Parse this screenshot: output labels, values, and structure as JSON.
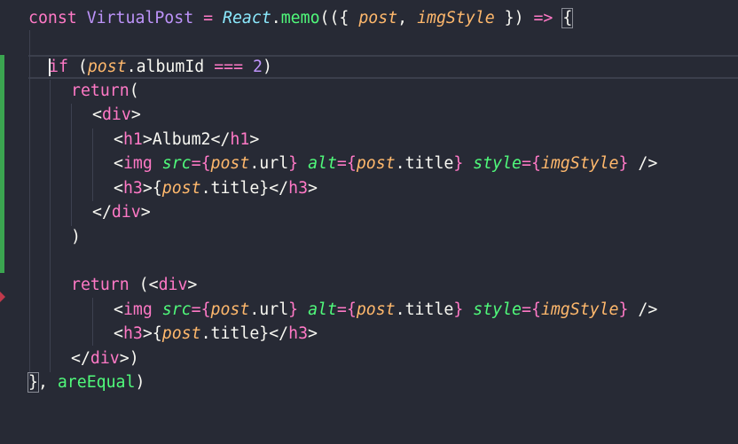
{
  "editor": {
    "line1": {
      "kw_const": "const",
      "name": "VirtualPost",
      "eq": "=",
      "react": "React",
      "dot": ".",
      "memo": "memo",
      "open": "(({",
      "post": "post",
      "comma": ",",
      "imgStyle": "imgStyle",
      "close": "})",
      "arrow": "=>",
      "brace": "{"
    },
    "line3": {
      "kw_if": "if",
      "paren_open": "(",
      "post": "post",
      "prop": ".albumId",
      "op": "===",
      "num": "2",
      "paren_close": ")"
    },
    "line4": {
      "kw_return": "return",
      "paren": "("
    },
    "line5": {
      "lt": "<",
      "tag": "div",
      "gt": ">"
    },
    "line6": {
      "lt": "<",
      "tag_open": "h1",
      "mid": ">Album2</",
      "tag_close": "h1",
      "gt": ">"
    },
    "img_line": {
      "lt": "<",
      "tag": "img",
      "attr_src": "src",
      "eq_brace": "={",
      "post": "post",
      "url": ".url",
      "brace_close": "}",
      "attr_alt": "alt",
      "title": ".title",
      "attr_style": "style",
      "imgStyle": "imgStyle",
      "end": "/>"
    },
    "h3_line": {
      "lt": "<",
      "tag": "h3",
      "gt_brace": ">{",
      "post": "post",
      "title": ".title",
      "brace_lt": "}</",
      "tag_close": "h3",
      "gt": ">"
    },
    "line9": {
      "lt": "</",
      "tag": "div",
      "gt": ">"
    },
    "line10": {
      "paren": ")"
    },
    "line12": {
      "kw_return": "return",
      "paren": "(<",
      "tag": "div",
      "gt": ">"
    },
    "line15": {
      "lt": "</",
      "tag": "div",
      "gt": ">)"
    },
    "line16": {
      "brace": "}",
      "comma": ",",
      "areEqual": "areEqual",
      "paren": ")"
    }
  }
}
